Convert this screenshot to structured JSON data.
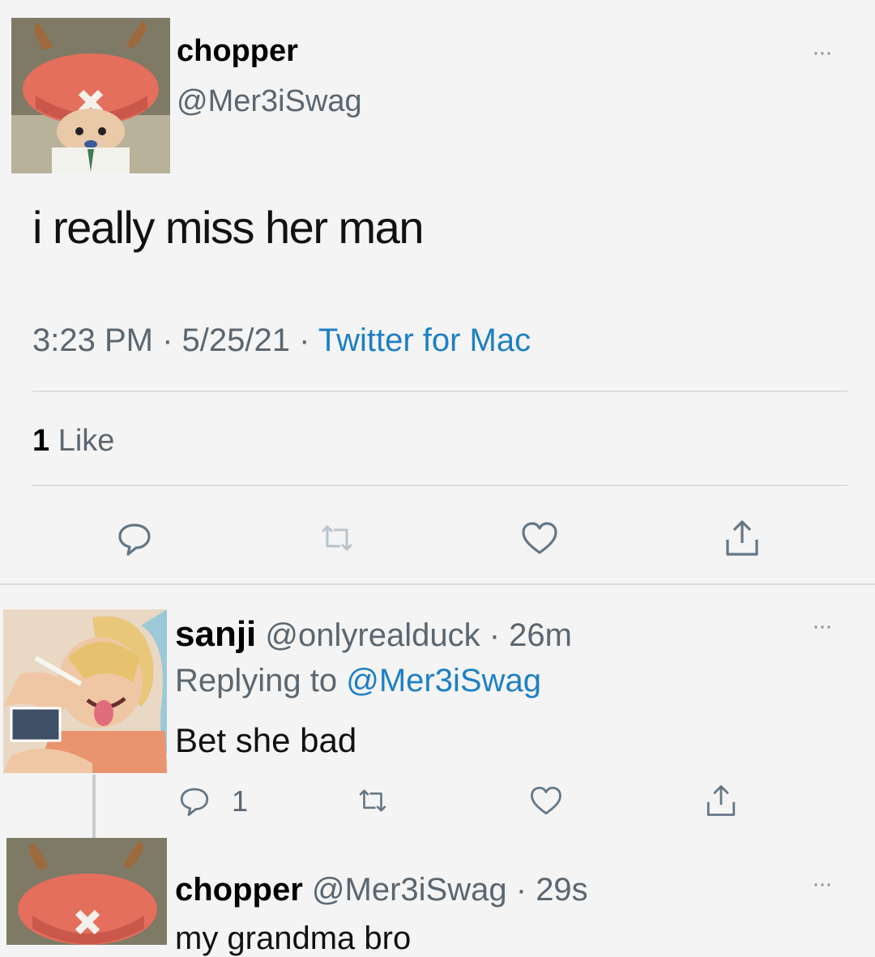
{
  "main_tweet": {
    "name": "chopper",
    "handle": "@Mer3iSwag",
    "text": "i really miss her man",
    "time": "3:23 PM",
    "separator": "·",
    "date": "5/25/21",
    "source": "Twitter for Mac",
    "likes_count": "1",
    "likes_label": "Like",
    "more": "···"
  },
  "reply": {
    "name": "sanji",
    "handle": "@onlyrealduck",
    "age": "26m",
    "separator": "·",
    "replying_prefix": "Replying to",
    "replying_handle": "@Mer3iSwag",
    "text": "Bet she bad",
    "reply_count": "1",
    "more": "···"
  },
  "second_reply": {
    "name": "chopper",
    "handle": "@Mer3iSwag",
    "age": "29s",
    "separator": "·",
    "text": "my grandma bro",
    "more": "···"
  },
  "colors": {
    "background": "#f4f4f4",
    "text": "#0f1419",
    "secondary": "#5b6670",
    "link": "#1d7fc4",
    "divider": "#dadde0"
  },
  "icons": [
    "reply-icon",
    "retweet-icon",
    "like-icon",
    "share-icon",
    "more-icon"
  ]
}
